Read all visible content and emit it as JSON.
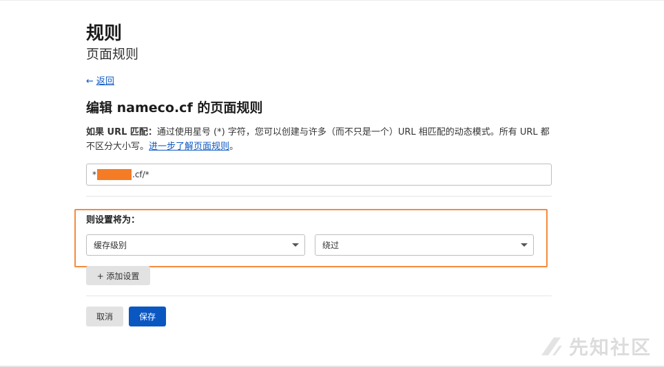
{
  "header": {
    "title": "规则",
    "subtitle": "页面规则"
  },
  "nav": {
    "back_arrow": "←",
    "back_label": "返回"
  },
  "editor": {
    "title": "编辑 nameco.cf 的页面规则",
    "desc_prefix": "如果 URL 匹配：",
    "desc_text": "通过使用星号 (*) 字符，您可以创建与许多（而不只是一个）URL 相匹配的动态模式。所有 URL 都不区分大小写。",
    "desc_link": "进一步了解页面规则",
    "desc_suffix": "。",
    "url_prefix": "*",
    "url_suffix": ".cf/*"
  },
  "settings": {
    "label": "则设置将为：",
    "setting_select": "缓存级别",
    "value_select": "绕过",
    "add_label": "+ 添加设置"
  },
  "actions": {
    "cancel_label": "取消",
    "save_label": "保存"
  },
  "watermark": {
    "text": "先知社区"
  },
  "colors": {
    "link": "#0a57c2",
    "primary": "#0a57c2",
    "highlight_border": "#f48a3b",
    "redaction": "#f47c26"
  }
}
